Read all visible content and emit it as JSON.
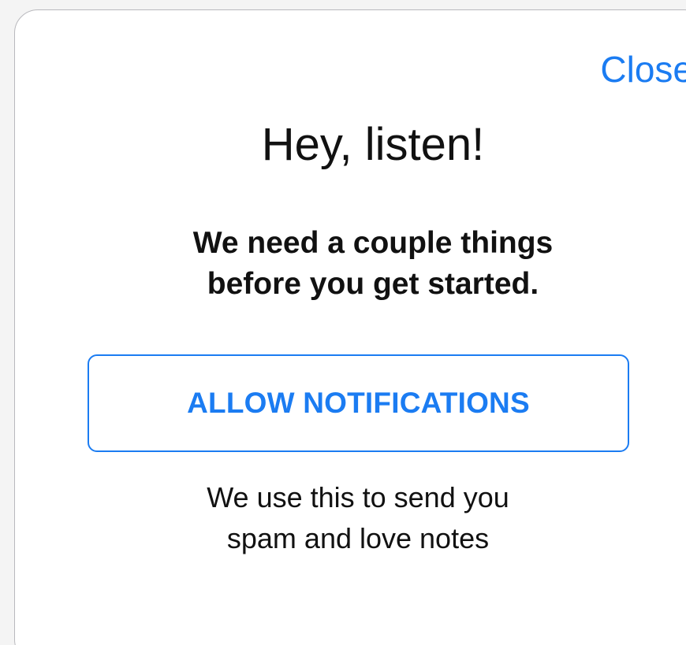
{
  "dialog": {
    "close_label": "Close",
    "title": "Hey, listen!",
    "subtitle_line1": "We need a couple things",
    "subtitle_line2": "before you get started.",
    "allow_button_label": "ALLOW NOTIFICATIONS",
    "helper_line1": "We use this to send you",
    "helper_line2": "spam and love notes"
  },
  "colors": {
    "accent": "#1b7cf2",
    "text": "#111111",
    "background": "#ffffff",
    "page_background": "#f4f4f4",
    "card_border": "#b9b9bd"
  }
}
